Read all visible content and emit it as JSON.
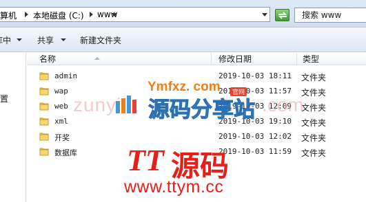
{
  "address_bar": {
    "crumbs": [
      "算机",
      "本地磁盘 (C:)",
      "www"
    ],
    "search_placeholder": "搜索 www"
  },
  "toolbar": {
    "organize_label": "库中",
    "share_label": "共享",
    "new_folder_label": "新建文件夹"
  },
  "nav_pane": {
    "item_label": "置"
  },
  "columns": {
    "name": "名称",
    "modified": "修改日期",
    "type": "类型"
  },
  "files": [
    {
      "name": "admin",
      "modified": "2019-10-03 18:11",
      "type": "文件夹"
    },
    {
      "name": "wap",
      "modified": "2019-10-03 11:57",
      "type": "文件夹"
    },
    {
      "name": "web",
      "modified": "2019-10-03 12:09",
      "type": "文件夹"
    },
    {
      "name": "xml",
      "modified": "2019-10-03 19:10",
      "type": "文件夹"
    },
    {
      "name": "开奖",
      "modified": "2019-10-03 12:02",
      "type": "文件夹"
    },
    {
      "name": "数据库",
      "modified": "2019-10-03 11:59",
      "type": "文件夹"
    }
  ],
  "watermark": {
    "zunyi": "zunyi",
    "com": ".com",
    "ymfxz": "Ymfxz. com",
    "badge": "官网",
    "cn_name": "源码分享站",
    "tt": "TT",
    "tt_cn": "源码",
    "url": "www.ttym.cc"
  },
  "colors": {
    "folder": "#f2c94c",
    "go_button": "#3e9b2e",
    "watermark_red": "#e81f19",
    "watermark_blue": "#4596d9",
    "watermark_orange": "#f07f18"
  }
}
